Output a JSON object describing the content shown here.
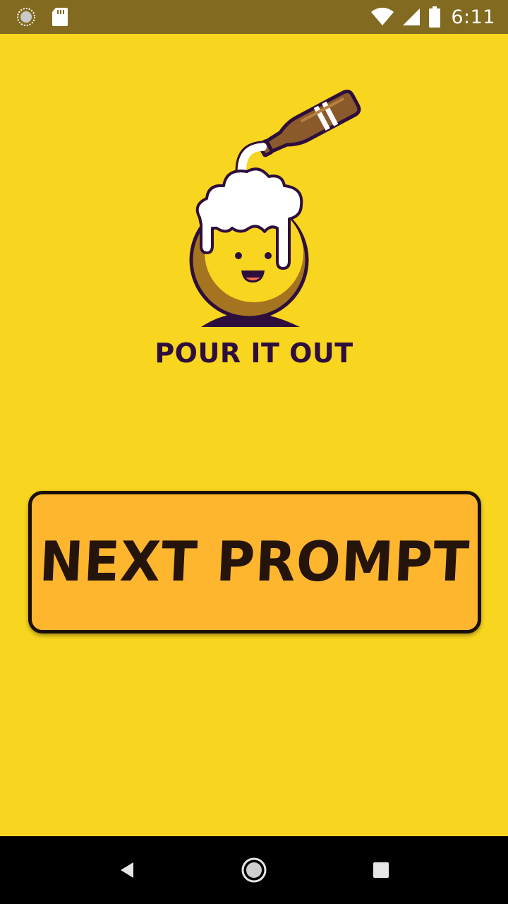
{
  "status_bar": {
    "time": "6:11",
    "icons": [
      "sync-icon",
      "sd-card-icon",
      "wifi-icon",
      "signal-icon",
      "battery-icon"
    ]
  },
  "app": {
    "title": "POUR IT OUT",
    "logo": "beer-pouring-mascot",
    "next_button_label": "NEXT PROMPT"
  },
  "colors": {
    "background": "#F8D51E",
    "status_bar": "#826A20",
    "button_fill": "#FFB62F",
    "button_border": "#1A0F07",
    "title_text": "#2E0E3D"
  },
  "nav_bar": {
    "buttons": [
      "back-icon",
      "home-icon",
      "recents-icon"
    ]
  }
}
